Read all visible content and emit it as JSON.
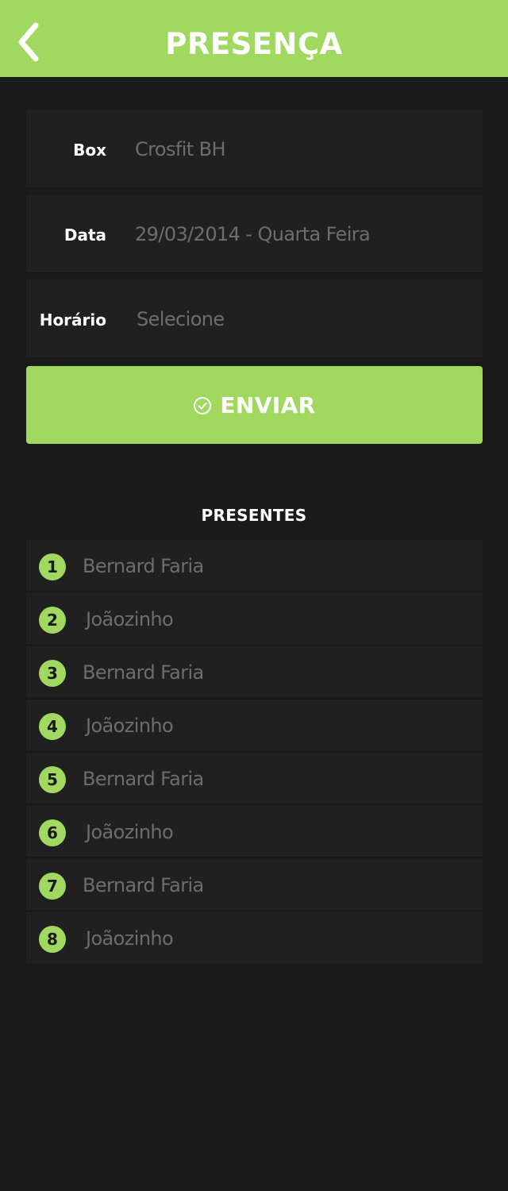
{
  "header": {
    "title": "PRESENÇA",
    "back_icon": "chevron-left-icon"
  },
  "form": {
    "box": {
      "label": "Box",
      "value": "Crosfit BH"
    },
    "data": {
      "label": "Data",
      "value": "29/03/2014 - Quarta Feira"
    },
    "horario": {
      "label": "Horário",
      "placeholder": "Selecione"
    }
  },
  "submit": {
    "label": "ENVIAR",
    "icon": "check-circle-icon"
  },
  "presentes": {
    "title": "PRESENTES",
    "items": [
      {
        "num": "1",
        "name": "Bernard Faria"
      },
      {
        "num": "2",
        "name": "Joãozinho"
      },
      {
        "num": "3",
        "name": "Bernard Faria"
      },
      {
        "num": "4",
        "name": "Joãozinho"
      },
      {
        "num": "5",
        "name": "Bernard Faria"
      },
      {
        "num": "6",
        "name": "Joãozinho"
      },
      {
        "num": "7",
        "name": "Bernard Faria"
      },
      {
        "num": "8",
        "name": "Joãozinho"
      }
    ]
  },
  "colors": {
    "accent": "#a0d860",
    "background": "#1a1a1a",
    "row": "#202020",
    "muted_text": "#6d6d6d"
  }
}
